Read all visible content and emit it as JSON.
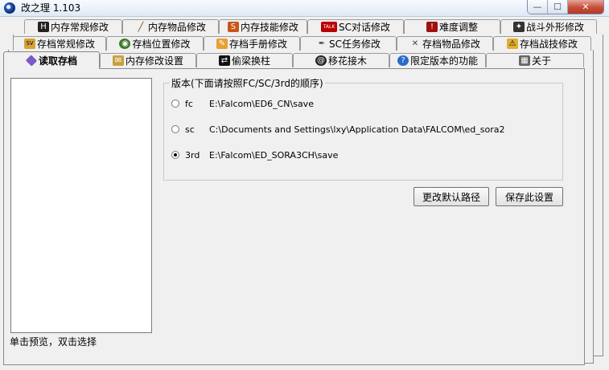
{
  "window": {
    "title": "改之理 1.103",
    "min_label": "—",
    "max_label": "☐",
    "close_label": "✕"
  },
  "tabs": {
    "row1": [
      {
        "label": "内存常规修改",
        "icon": "hp-icon"
      },
      {
        "label": "内存物品修改",
        "icon": "sword-icon"
      },
      {
        "label": "内存技能修改",
        "icon": "skill-scroll-icon"
      },
      {
        "label": "SC对话修改",
        "icon": "talk-icon"
      },
      {
        "label": "难度调整",
        "icon": "difficulty-icon"
      },
      {
        "label": "战斗外形修改",
        "icon": "battle-form-icon"
      }
    ],
    "row2": [
      {
        "label": "存档常规修改",
        "icon": "save-icon"
      },
      {
        "label": "存档位置修改",
        "icon": "location-icon"
      },
      {
        "label": "存档手册修改",
        "icon": "handbook-icon"
      },
      {
        "label": "SC任务修改",
        "icon": "quill-icon"
      },
      {
        "label": "存档物品修改",
        "icon": "crossed-swords-icon"
      },
      {
        "label": "存档战技修改",
        "icon": "warning-icon"
      }
    ],
    "row3": [
      {
        "label": "读取存档",
        "icon": "load-icon"
      },
      {
        "label": "内存修改设置",
        "icon": "settings-icon"
      },
      {
        "label": "偷梁换柱",
        "icon": "swap-icon"
      },
      {
        "label": "移花接木",
        "icon": "graft-icon"
      },
      {
        "label": "限定版本的功能",
        "icon": "help-icon"
      },
      {
        "label": "关于",
        "icon": "about-icon"
      }
    ]
  },
  "load": {
    "hint": "单击预览，双击选择",
    "group_title": "版本(下面请按照FC/SC/3rd的顺序)",
    "versions": [
      {
        "label": "fc",
        "path": "E:\\Falcom\\ED6_CN\\save",
        "checked": false
      },
      {
        "label": "sc",
        "path": "C:\\Documents and Settings\\lxy\\Application Data\\FALCOM\\ed_sora2",
        "checked": false
      },
      {
        "label": "3rd",
        "path": "E:\\Falcom\\ED_SORA3CH\\save",
        "checked": true
      }
    ],
    "change_default_button": "更改默认路径",
    "save_settings_button": "保存此设置"
  }
}
